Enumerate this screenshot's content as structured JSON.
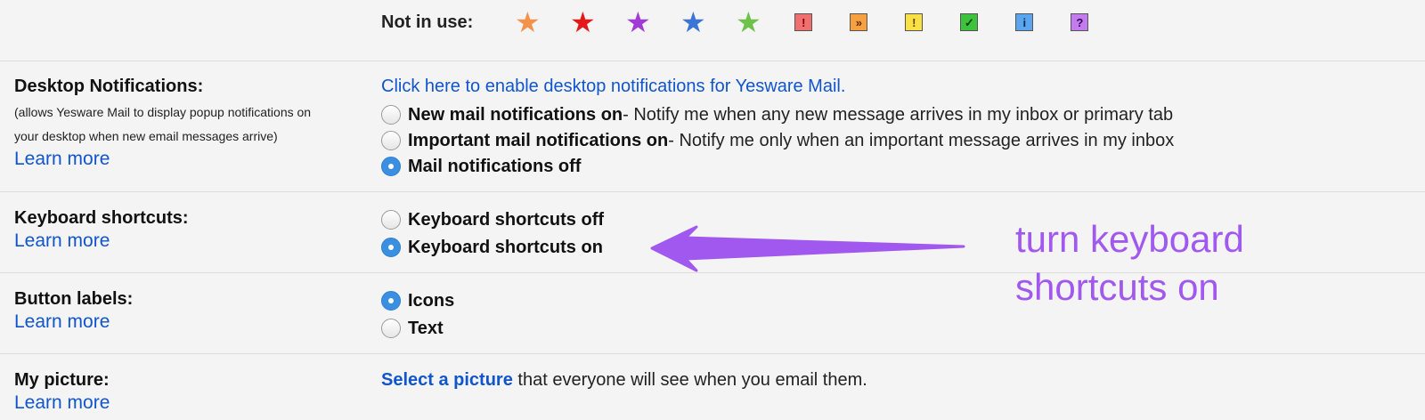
{
  "stars_row": {
    "label": "Not in use:",
    "stars": [
      {
        "icon": "orange-star-icon",
        "glyph": "★",
        "color": "#f3924a"
      },
      {
        "icon": "red-star-icon",
        "glyph": "★",
        "color": "#e31919"
      },
      {
        "icon": "purple-star-icon",
        "glyph": "★",
        "color": "#a23ad6"
      },
      {
        "icon": "blue-star-icon",
        "glyph": "★",
        "color": "#3c75d6"
      },
      {
        "icon": "green-star-icon",
        "glyph": "★",
        "color": "#6cc24a"
      },
      {
        "icon": "red-bang-icon",
        "glyph": "!",
        "bg": "#f07070",
        "fg": "#7a0000"
      },
      {
        "icon": "orange-guillemet-icon",
        "glyph": "»",
        "bg": "#f6a040",
        "fg": "#5a2a00"
      },
      {
        "icon": "yellow-bang-icon",
        "glyph": "!",
        "bg": "#fbe045",
        "fg": "#5a4a00"
      },
      {
        "icon": "green-check-icon",
        "glyph": "✓",
        "bg": "#3dc23d",
        "fg": "#0b3d0b"
      },
      {
        "icon": "blue-info-icon",
        "glyph": "i",
        "bg": "#5aa5ee",
        "fg": "#0a2a55"
      },
      {
        "icon": "purple-question-icon",
        "glyph": "?",
        "bg": "#c47bf0",
        "fg": "#3a0a55"
      }
    ]
  },
  "desktop_notifications": {
    "label": "Desktop Notifications:",
    "desc_line1": "(allows Yesware Mail to display popup notifications on",
    "desc_line2": "your desktop when new email messages arrive)",
    "learn_more": "Learn more",
    "enable_link": "Click here to enable desktop notifications for Yesware Mail.",
    "options": [
      {
        "bold": "New mail notifications on",
        "rest": " - Notify me when any new message arrives in my inbox or primary tab",
        "checked": false
      },
      {
        "bold": "Important mail notifications on",
        "rest": " - Notify me only when an important message arrives in my inbox",
        "checked": false
      },
      {
        "bold": "Mail notifications off",
        "rest": "",
        "checked": true
      }
    ]
  },
  "keyboard_shortcuts": {
    "label": "Keyboard shortcuts:",
    "learn_more": "Learn more",
    "options": [
      {
        "bold": "Keyboard shortcuts off",
        "checked": false
      },
      {
        "bold": "Keyboard shortcuts on",
        "checked": true
      }
    ]
  },
  "button_labels": {
    "label": "Button labels:",
    "learn_more": "Learn more",
    "options": [
      {
        "bold": "Icons",
        "checked": true
      },
      {
        "bold": "Text",
        "checked": false
      }
    ]
  },
  "my_picture": {
    "label": "My picture:",
    "learn_more": "Learn more",
    "select_link": "Select a picture",
    "rest": " that everyone will see when you email them."
  },
  "annotation": {
    "line1": "turn keyboard",
    "line2": "shortcuts on",
    "color": "#a158ee"
  }
}
